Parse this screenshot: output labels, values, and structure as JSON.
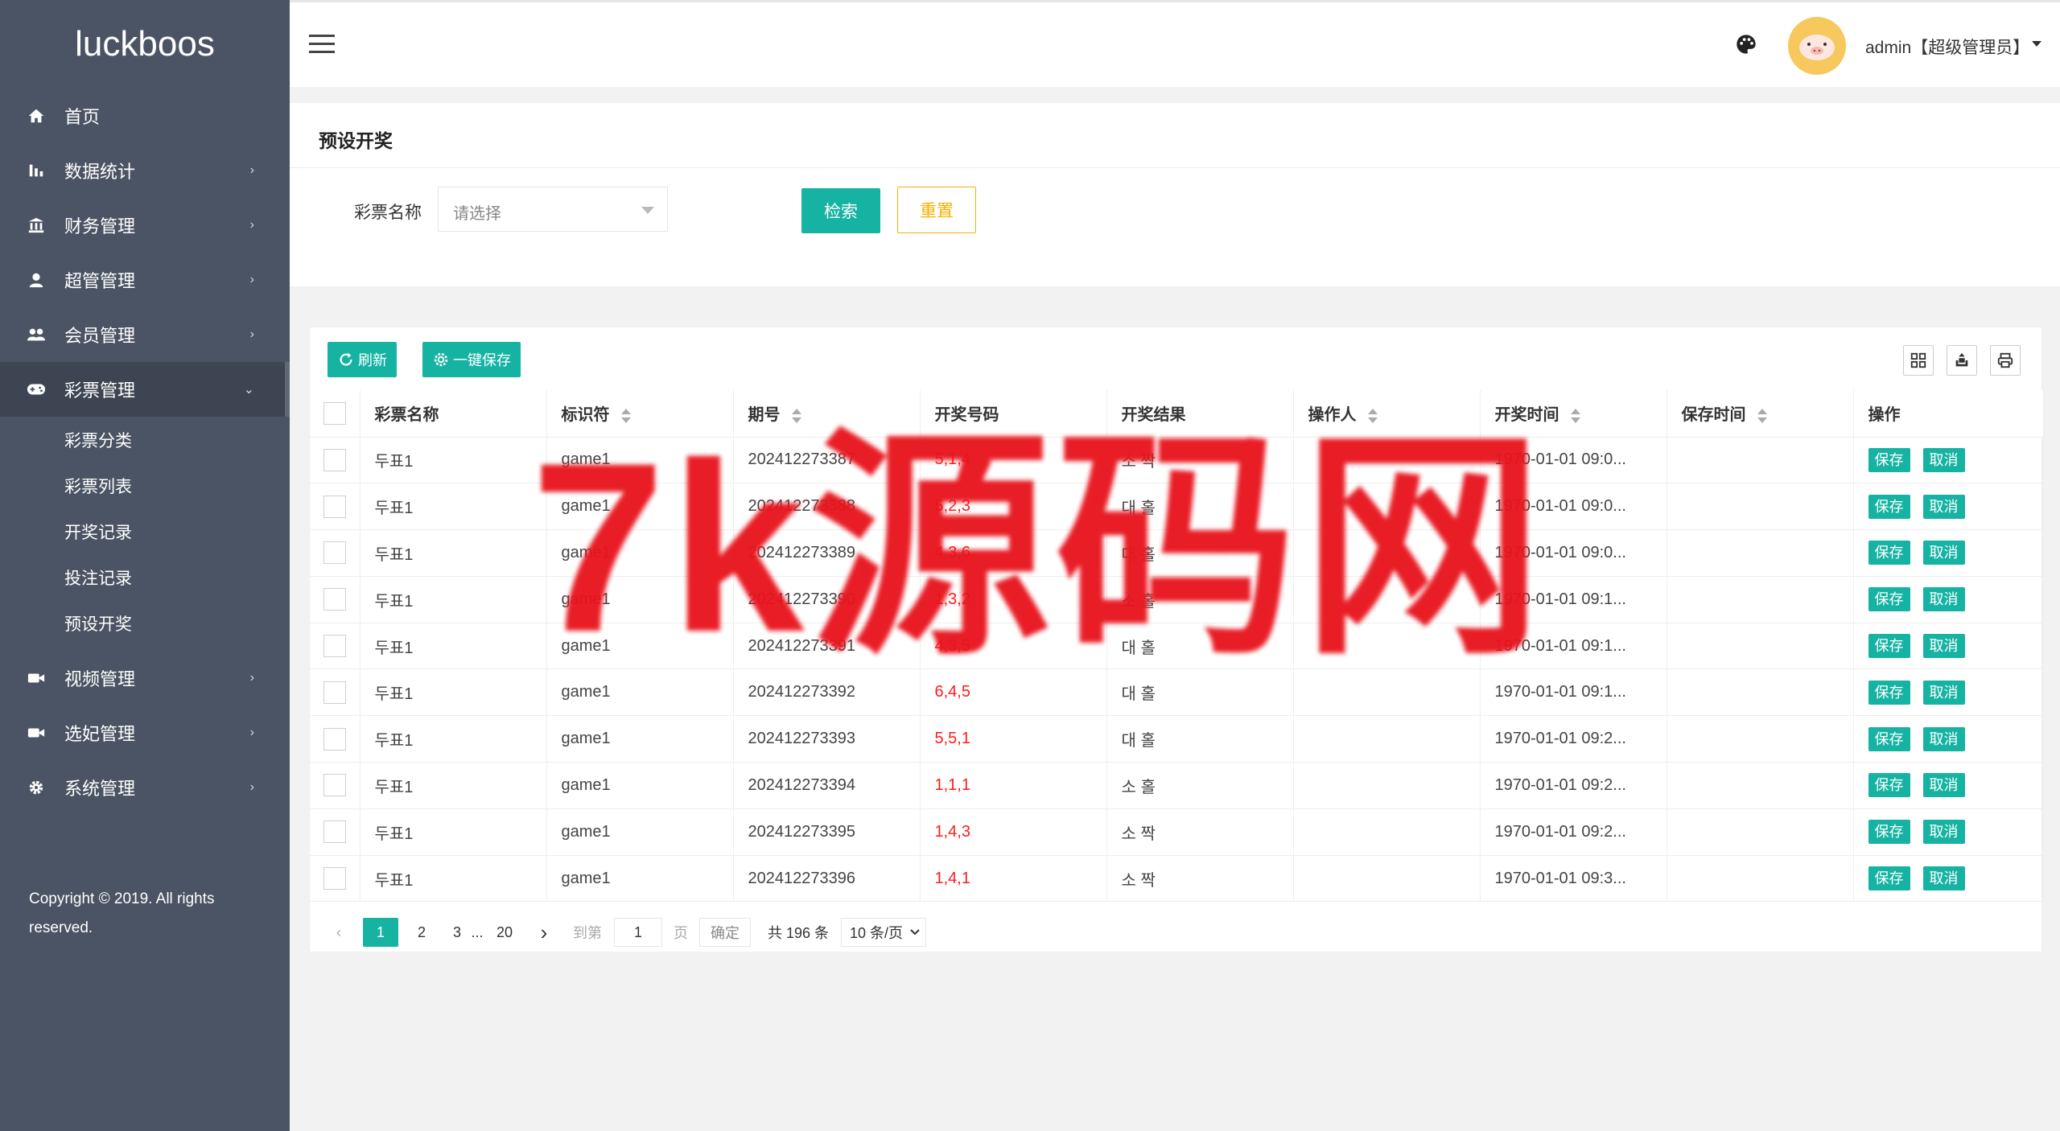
{
  "sidebar": {
    "logo": "luckboos",
    "items": [
      {
        "label": "首页",
        "icon": "home-icon",
        "chevron": ""
      },
      {
        "label": "数据统计",
        "icon": "bar-chart-icon",
        "chevron": "›"
      },
      {
        "label": "财务管理",
        "icon": "bank-icon",
        "chevron": "›"
      },
      {
        "label": "超管管理",
        "icon": "user-icon",
        "chevron": "›"
      },
      {
        "label": "会员管理",
        "icon": "users-icon",
        "chevron": "›"
      },
      {
        "label": "彩票管理",
        "icon": "gamepad-icon",
        "chevron": "⌄"
      },
      {
        "label": "视频管理",
        "icon": "video-icon",
        "chevron": "›"
      },
      {
        "label": "选妃管理",
        "icon": "video-icon",
        "chevron": "›"
      },
      {
        "label": "系统管理",
        "icon": "gear-icon",
        "chevron": "›"
      }
    ],
    "subitems": [
      "彩票分类",
      "彩票列表",
      "开奖记录",
      "投注记录",
      "预设开奖"
    ],
    "copyright": "Copyright © 2019. All rights reserved."
  },
  "header": {
    "user": "admin【超级管理员】"
  },
  "search": {
    "title": "预设开奖",
    "label": "彩票名称",
    "placeholder": "请选择",
    "search_btn": "检索",
    "reset_btn": "重置"
  },
  "toolbar": {
    "refresh": "刷新",
    "save_all": "一键保存"
  },
  "table": {
    "headers": [
      "彩票名称",
      "标识符",
      "期号",
      "开奖号码",
      "开奖结果",
      "操作人",
      "开奖时间",
      "保存时间",
      "操作"
    ],
    "rows": [
      [
        "두표1",
        "game1",
        "202412273387",
        "5,1,4",
        "소 짝",
        "",
        "1970-01-01 09:0...",
        ""
      ],
      [
        "두표1",
        "game1",
        "202412273388",
        "5,2,3",
        "대 홀",
        "",
        "1970-01-01 09:0...",
        ""
      ],
      [
        "두표1",
        "game1",
        "202412273389",
        "4,3,6",
        "대 홀",
        "",
        "1970-01-01 09:0...",
        ""
      ],
      [
        "두표1",
        "game1",
        "202412273390",
        "1,3,2",
        "소 홀",
        "",
        "1970-01-01 09:1...",
        ""
      ],
      [
        "두표1",
        "game1",
        "202412273391",
        "4,3,5",
        "대 홀",
        "",
        "1970-01-01 09:1...",
        ""
      ],
      [
        "두표1",
        "game1",
        "202412273392",
        "6,4,5",
        "대 홀",
        "",
        "1970-01-01 09:1...",
        ""
      ],
      [
        "두표1",
        "game1",
        "202412273393",
        "5,5,1",
        "대 홀",
        "",
        "1970-01-01 09:2...",
        ""
      ],
      [
        "두표1",
        "game1",
        "202412273394",
        "1,1,1",
        "소 홀",
        "",
        "1970-01-01 09:2...",
        ""
      ],
      [
        "두표1",
        "game1",
        "202412273395",
        "1,4,3",
        "소 짝",
        "",
        "1970-01-01 09:2...",
        ""
      ],
      [
        "두표1",
        "game1",
        "202412273396",
        "1,4,1",
        "소 짝",
        "",
        "1970-01-01 09:3...",
        ""
      ]
    ],
    "op_save": "保存",
    "op_cancel": "取消"
  },
  "pager": {
    "pages": [
      "1",
      "2",
      "3",
      "...",
      "20"
    ],
    "goto": "到第",
    "input": "1",
    "page_unit": "页",
    "confirm": "确定",
    "total": "共 196 条",
    "limit": "10 条/页"
  },
  "watermark": "7k源码网",
  "colors": {
    "sidebar": "#4b5464",
    "accent": "#16b3a3",
    "reset": "#f5b000",
    "draw_number": "#ff1a1a",
    "watermark": "#e8141e"
  }
}
